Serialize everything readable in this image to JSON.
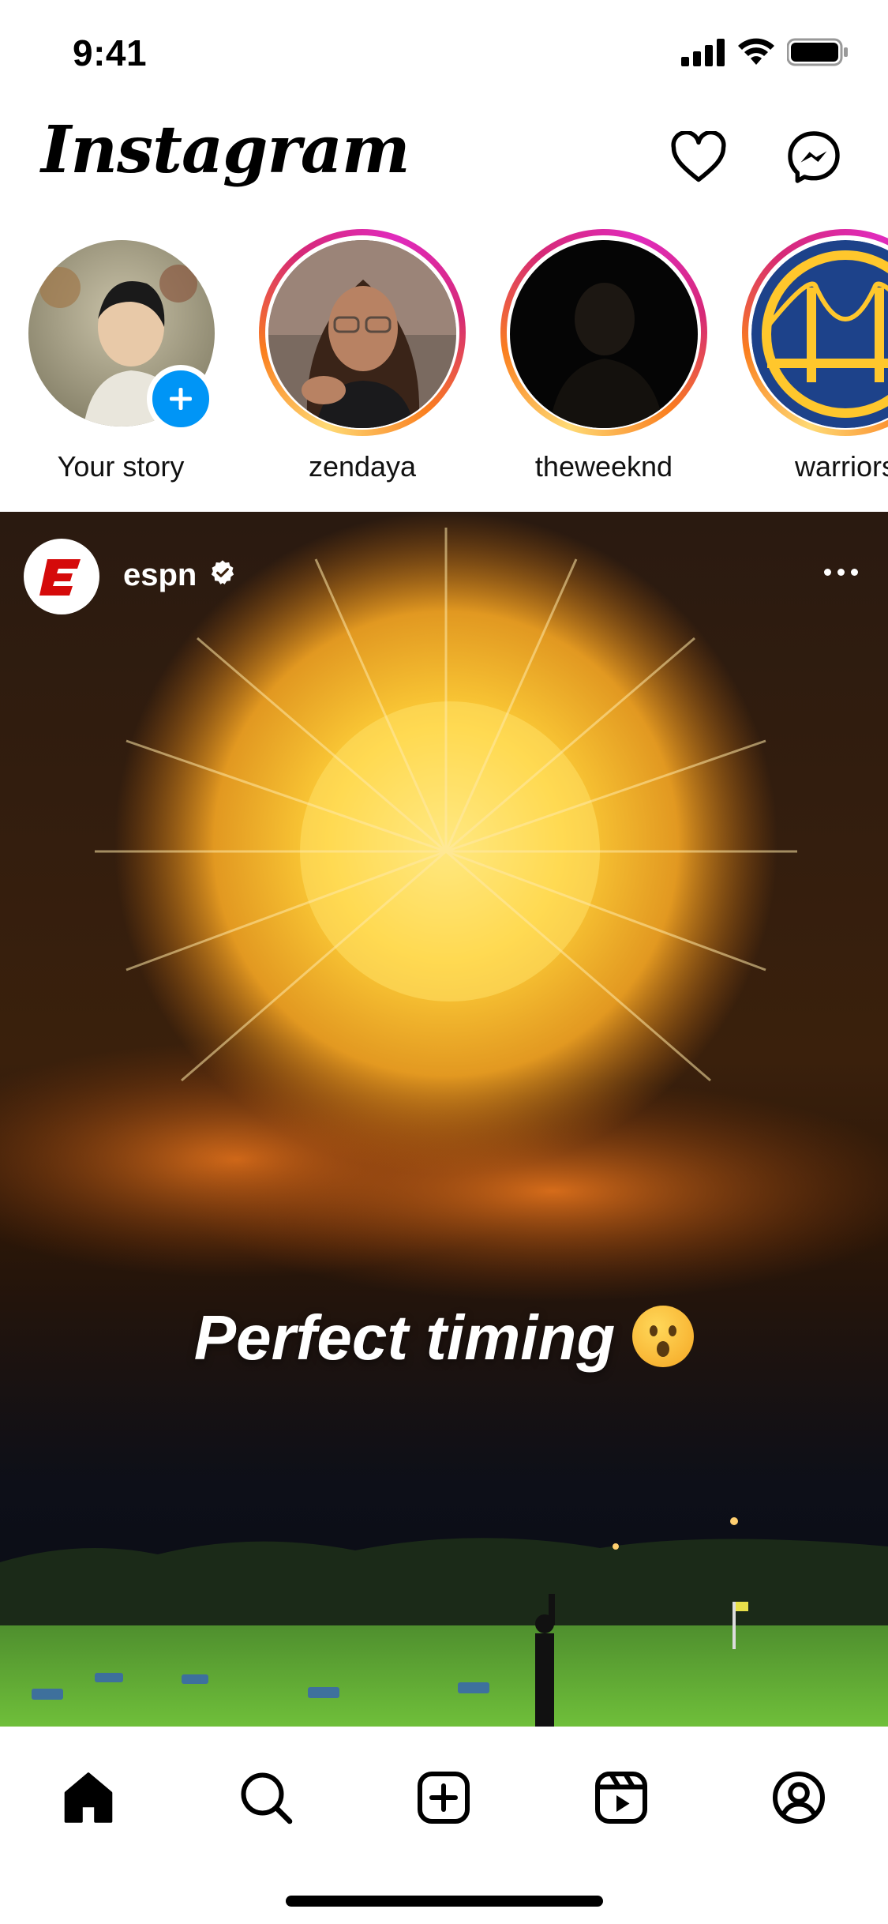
{
  "status_bar": {
    "time": "9:41"
  },
  "header": {
    "logo_text": "Instagram"
  },
  "stories": [
    {
      "label": "Your story",
      "own": true
    },
    {
      "label": "zendaya"
    },
    {
      "label": "theweeknd"
    },
    {
      "label": "warriors"
    }
  ],
  "post": {
    "username": "espn",
    "verified": true,
    "overlay_text": "Perfect timing"
  },
  "colors": {
    "accent_blue": "#0095f6",
    "story_ring_start": "#feda75",
    "story_ring_mid": "#fa7e1e",
    "story_ring_end": "#d62976",
    "espn_red": "#d50a0a"
  }
}
